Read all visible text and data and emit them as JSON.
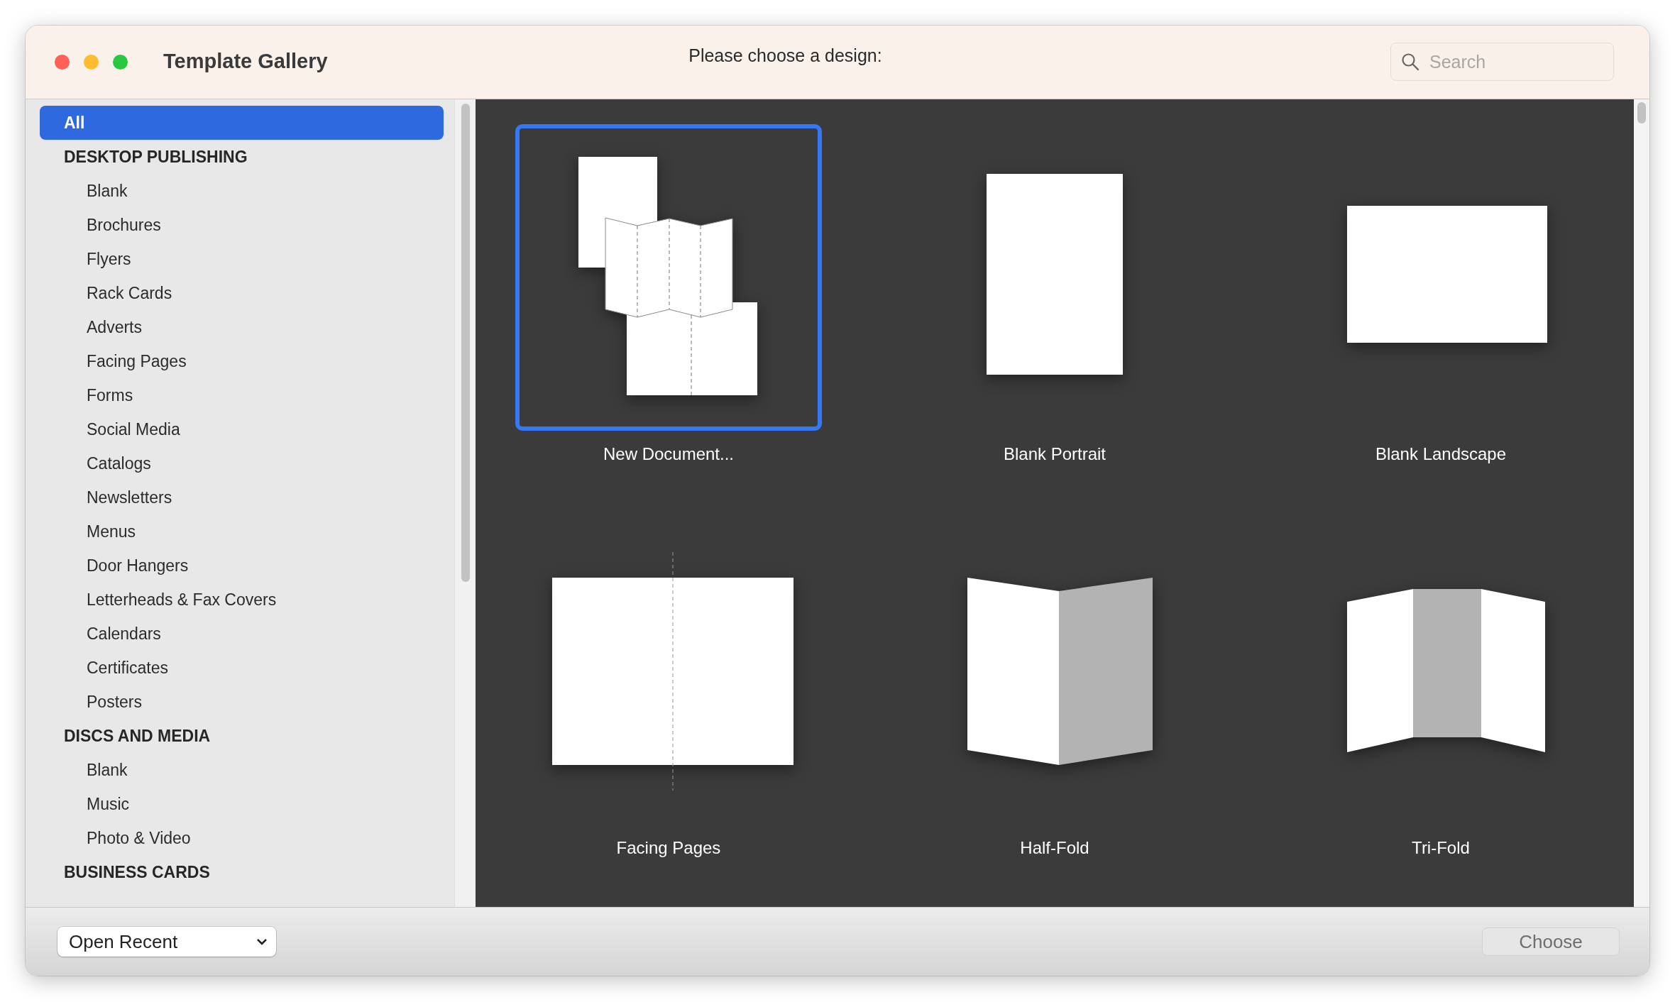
{
  "window": {
    "title": "Template Gallery",
    "prompt": "Please choose a design:"
  },
  "search": {
    "placeholder": "Search"
  },
  "sidebar": {
    "items": [
      {
        "label": "All",
        "selected": true
      },
      {
        "label": "DESKTOP PUBLISHING",
        "selected": false,
        "children": [
          {
            "label": "Blank",
            "selected": false
          },
          {
            "label": "Brochures",
            "selected": false
          },
          {
            "label": "Flyers",
            "selected": false
          },
          {
            "label": "Rack Cards",
            "selected": false
          },
          {
            "label": "Adverts",
            "selected": false
          },
          {
            "label": "Facing Pages",
            "selected": false
          },
          {
            "label": "Forms",
            "selected": false
          },
          {
            "label": "Social Media",
            "selected": false
          },
          {
            "label": "Catalogs",
            "selected": false
          },
          {
            "label": "Newsletters",
            "selected": false
          },
          {
            "label": "Menus",
            "selected": false
          },
          {
            "label": "Door Hangers",
            "selected": false
          },
          {
            "label": "Letterheads & Fax Covers",
            "selected": false
          },
          {
            "label": "Calendars",
            "selected": false
          },
          {
            "label": "Certificates",
            "selected": false
          },
          {
            "label": "Posters",
            "selected": false
          }
        ]
      },
      {
        "label": "DISCS AND MEDIA",
        "selected": false,
        "children": [
          {
            "label": "Blank",
            "selected": false
          },
          {
            "label": "Music",
            "selected": false
          },
          {
            "label": "Photo & Video",
            "selected": false
          }
        ]
      },
      {
        "label": "BUSINESS CARDS",
        "selected": false
      }
    ]
  },
  "templates": [
    {
      "label": "New Document...",
      "kind": "new-document",
      "selected": true
    },
    {
      "label": "Blank Portrait",
      "kind": "portrait",
      "selected": false
    },
    {
      "label": "Blank Landscape",
      "kind": "landscape",
      "selected": false
    },
    {
      "label": "Facing Pages",
      "kind": "facing",
      "selected": false
    },
    {
      "label": "Half-Fold",
      "kind": "half-fold",
      "selected": false
    },
    {
      "label": "Tri-Fold",
      "kind": "tri-fold",
      "selected": false
    }
  ],
  "bottom_bar": {
    "open_recent": "Open Recent",
    "choose_button": {
      "label": "Choose",
      "disabled": true
    }
  }
}
